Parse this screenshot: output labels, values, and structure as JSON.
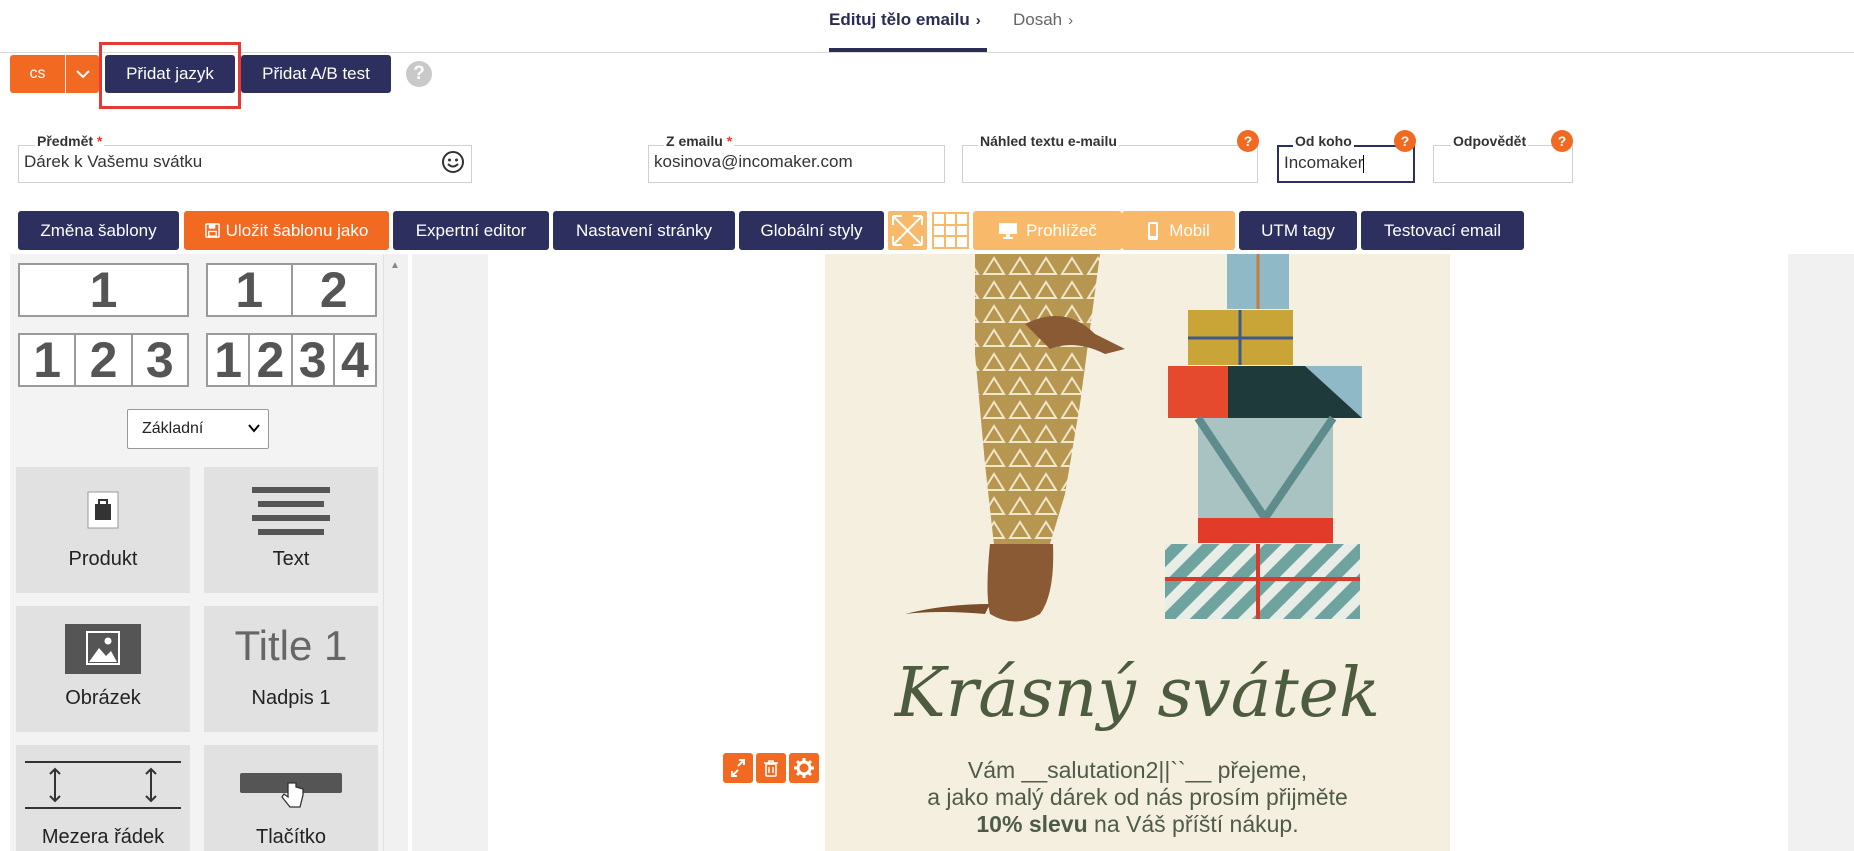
{
  "tabs": [
    {
      "label": "Edituj tělo emailu",
      "active": true
    },
    {
      "label": "Dosah",
      "active": false
    }
  ],
  "toolbar1": {
    "lang": "cs",
    "add_language": "Přidat jazyk",
    "add_ab_test": "Přidat A/B test"
  },
  "fields": {
    "subject": {
      "label": "Předmět",
      "value": "Dárek k Vašemu svátku"
    },
    "from_email": {
      "label": "Z emailu",
      "value": "kosinova@incomaker.com"
    },
    "preview": {
      "label": "Náhled textu e-mailu",
      "value": ""
    },
    "from_name": {
      "label": "Od koho",
      "value": "Incomaker"
    },
    "reply_to": {
      "label": "Odpovědět",
      "value": ""
    },
    "required_mark": "*",
    "help": "?"
  },
  "toolbar2": {
    "change_template": "Změna šablony",
    "save_template_as": "Uložit šablonu jako",
    "expert_editor": "Expertní editor",
    "page_settings": "Nastavení stránky",
    "global_styles": "Globální styly",
    "browser": "Prohlížeč",
    "mobile": "Mobil",
    "utm_tags": "UTM tagy",
    "test_email": "Testovací email"
  },
  "layouts": [
    [
      "1"
    ],
    [
      "1",
      "2"
    ],
    [
      "1",
      "2",
      "3"
    ],
    [
      "1",
      "2",
      "3",
      "4"
    ]
  ],
  "block_set": {
    "selected": "Základní"
  },
  "blocks": [
    {
      "label": "Produkt",
      "icon": "bag-icon"
    },
    {
      "label": "Text",
      "icon": "text-lines-icon"
    },
    {
      "label": "Obrázek",
      "icon": "image-icon"
    },
    {
      "label": "Nadpis 1",
      "icon": "title-icon",
      "icon_text": "Title 1"
    },
    {
      "label": "Mezera řádek",
      "icon": "spacer-icon"
    },
    {
      "label": "Tlačítko",
      "icon": "button-icon"
    }
  ],
  "email": {
    "title": "Krásný svátek",
    "line1": "Vám __salutation2||``__ přejeme,",
    "line2": "a jako malý dárek od nás prosím přijměte",
    "line3_bold": "10% slevu",
    "line3_rest": " na Váš příští nákup."
  },
  "colors": {
    "navy": "#2d2f5e",
    "orange": "#f26a21",
    "pale_orange": "#f8b96a",
    "highlight": "#e53935"
  }
}
